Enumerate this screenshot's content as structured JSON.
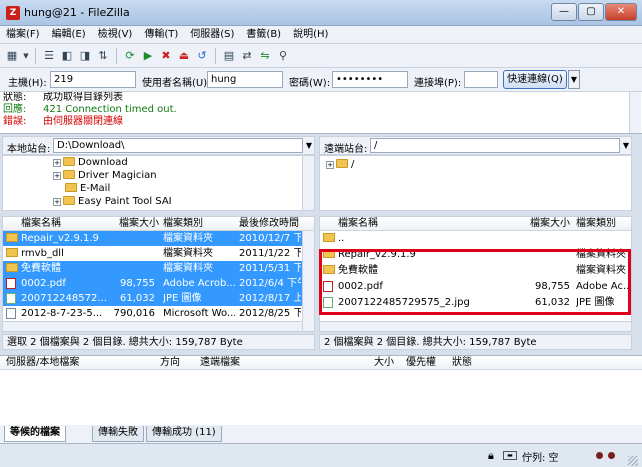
{
  "window": {
    "app_icon": "Z",
    "title": "hung@21            - FileZilla",
    "buttons": [
      "—",
      "▢",
      "✕"
    ]
  },
  "menu": [
    "檔案(F)",
    "編輯(E)",
    "檢視(V)",
    "傳輸(T)",
    "伺服器(S)",
    "書籤(B)",
    "說明(H)"
  ],
  "toolbar_icons": [
    "server-manager-icon",
    "dropdown-icon",
    "message-log-icon",
    "local-tree-icon",
    "remote-tree-icon",
    "queue-icon",
    "refresh-icon",
    "process-queue-icon",
    "cancel-icon",
    "disconnect-icon",
    "reconnect-icon",
    "filter-icon",
    "compare-icon",
    "sync-browse-icon",
    "search-icon"
  ],
  "quickconnect": {
    "host_label": "主機(H):",
    "host_value": "219",
    "user_label": "使用者名稱(U):",
    "user_value": "hung",
    "pass_label": "密碼(W):",
    "pass_value": "••••••••",
    "port_label": "連接埠(P):",
    "port_value": "",
    "button": "快速連線(Q)",
    "dropdown": "▼"
  },
  "log": [
    {
      "key": "狀態:",
      "text": "成功取得目錄列表",
      "color": "#000000"
    },
    {
      "key": "回應:",
      "text": "421 Connection timed out.",
      "color": "#117a11"
    },
    {
      "key": "錯誤:",
      "text": "由伺服器關閉連線",
      "color": "#d40000"
    }
  ],
  "local": {
    "label": "本地站台:",
    "path": "D:\\Download\\",
    "tree": [
      {
        "name": "Download",
        "expander": "+"
      },
      {
        "name": "Driver Magician",
        "expander": "+"
      },
      {
        "name": "E-Mail",
        "expander": ""
      },
      {
        "name": "Easy Paint Tool SAI",
        "expander": "+"
      }
    ],
    "columns": [
      "檔案名稱",
      "檔案大小",
      "檔案類別",
      "最後修改時間"
    ],
    "files": [
      {
        "name": "Repair_v2.9.1.9",
        "size": "",
        "type": "檔案資料夾",
        "date": "2010/12/7 下午",
        "icon": "dir",
        "selected": true
      },
      {
        "name": "rmvb_dll",
        "size": "",
        "type": "檔案資料夾",
        "date": "2011/1/22 下午",
        "icon": "dir",
        "selected": false
      },
      {
        "name": "免費軟體",
        "size": "",
        "type": "檔案資料夾",
        "date": "2011/5/31 下午",
        "icon": "dir",
        "selected": true
      },
      {
        "name": "0002.pdf",
        "size": "98,755",
        "type": "Adobe Acrob...",
        "date": "2012/6/4 下午",
        "icon": "pdf",
        "selected": true
      },
      {
        "name": "200712248572...",
        "size": "61,032",
        "type": "JPE 圖像",
        "date": "2012/8/17 上午",
        "icon": "jpg",
        "selected": true
      },
      {
        "name": "2012-8-7-23-5...",
        "size": "790,016",
        "type": "Microsoft Wo...",
        "date": "2012/8/25 下午",
        "icon": "file",
        "selected": false
      }
    ],
    "status": "選取 2 個檔案與 2 個目錄. 總共大小: 159,787 Byte"
  },
  "remote": {
    "label": "遠端站台:",
    "path": "/",
    "tree": [
      {
        "name": "/",
        "expander": "+"
      }
    ],
    "columns": [
      "檔案名稱",
      "檔案大小",
      "檔案類別"
    ],
    "files": [
      {
        "name": "..",
        "size": "",
        "type": "",
        "icon": "dir"
      },
      {
        "name": "Repair_v2.9.1.9",
        "size": "",
        "type": "檔案資料夾",
        "icon": "dir"
      },
      {
        "name": "免費軟體",
        "size": "",
        "type": "檔案資料夾",
        "icon": "dir"
      },
      {
        "name": "0002.pdf",
        "size": "98,755",
        "type": "Adobe Ac...",
        "icon": "pdf"
      },
      {
        "name": "2007122485729575_2.jpg",
        "size": "61,032",
        "type": "JPE 圖像",
        "icon": "jpg"
      }
    ],
    "status": "2 個檔案與 2 個目錄. 總共大小: 159,787 Byte"
  },
  "queue": {
    "columns": [
      "伺服器/本地檔案",
      "方向",
      "遠端檔案",
      "大小",
      "優先權",
      "狀態"
    ]
  },
  "tabs": [
    "等候的檔案",
    "傳輸失敗",
    "傳輸成功 (11)"
  ],
  "statusbar": {
    "queue_text": "佇列: 空"
  },
  "colors": {
    "selection": "#3399ff",
    "highlight": "#e0001a"
  }
}
